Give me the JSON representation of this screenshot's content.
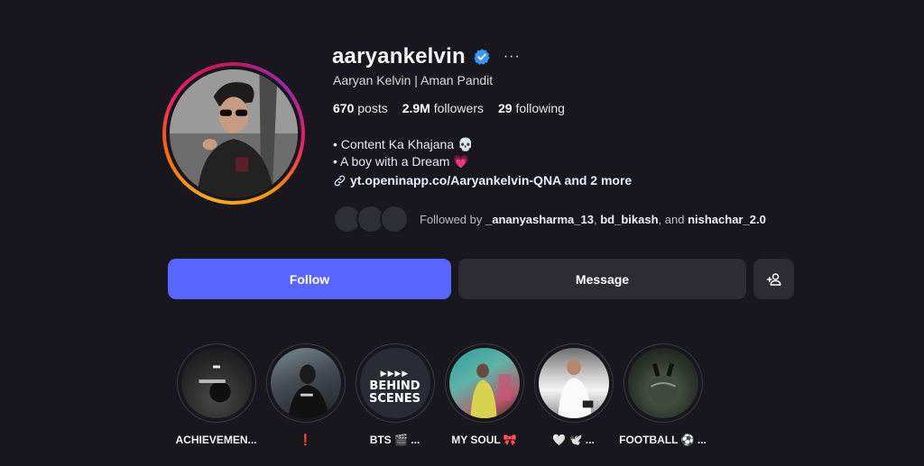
{
  "profile": {
    "username": "aaryankelvin",
    "more_label": "···",
    "full_name": "Aaryan Kelvin | Aman Pandit",
    "stats": {
      "posts_count": "670",
      "posts_label": "posts",
      "followers_count": "2.9M",
      "followers_label": "followers",
      "following_count": "29",
      "following_label": "following"
    },
    "bio": {
      "line1": "• Content Ka Khajana 💀",
      "line2": "• A boy with a Dream 💗",
      "link": "yt.openinapp.co/Aaryankelvin-QNA and 2 more"
    },
    "followed_by": {
      "prefix": "Followed by",
      "user1": "_ananyasharma_13",
      "sep1": ",",
      "user2": "bd_bikash",
      "sep2": ", and",
      "user3": "nishachar_2.0"
    }
  },
  "actions": {
    "follow_label": "Follow",
    "message_label": "Message",
    "add_user_icon": "person-add-icon"
  },
  "highlights": [
    {
      "label": "ACHIEVEMEN..."
    },
    {
      "label": "❗"
    },
    {
      "label": "BTS 🎬 ...",
      "cover_text": {
        "line1": "BEHIND",
        "line2": "SCENES"
      }
    },
    {
      "label": "MY SOUL 🎀"
    },
    {
      "label": "🤍 🕊️ ..."
    },
    {
      "label": "FOOTBALL ⚽ ..."
    }
  ],
  "colors": {
    "background": "#17171d",
    "follow_button": "#5865ff",
    "secondary_button": "#2c2c32",
    "verified_badge": "#3897f0"
  }
}
